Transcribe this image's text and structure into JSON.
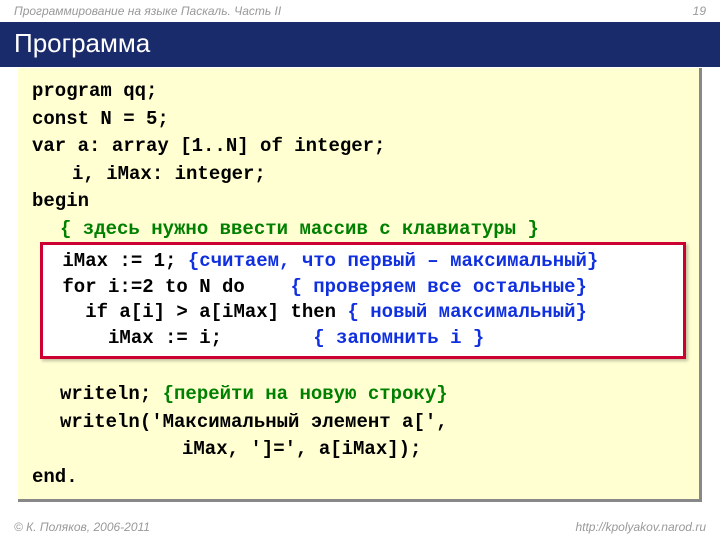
{
  "header": {
    "course": "Программирование на языке Паскаль. Часть II",
    "page": "19"
  },
  "title": "Программа",
  "code": {
    "l1": "program qq;",
    "l2": "const N = 5;",
    "l3": "var a: array [1..N] of integer;",
    "l4": "i, iMax: integer;",
    "l5": "begin",
    "l6": "{ здесь нужно ввести массив с клавиатуры }",
    "l7a": "writeln; ",
    "l7b": "{перейти на новую строку}",
    "l8": "writeln('Максимальный элемент a[',",
    "l9": "iMax, ']=', a[iMax]);",
    "l10": "end."
  },
  "overlay": {
    "o1a": " iMax := 1; ",
    "o1b": "{считаем, что первый – максимальный}",
    "o2a": " for i:=2 to N do    ",
    "o2b": "{ проверяем все остальные}",
    "o3a": "   if a[i] > a[iMax] then ",
    "o3b": "{ новый максимальный}",
    "o4a": "     iMax := i;        ",
    "o4b": "{ запомнить i }"
  },
  "footer": {
    "copyright": "© К. Поляков, 2006-2011",
    "url": "http://kpolyakov.narod.ru"
  }
}
